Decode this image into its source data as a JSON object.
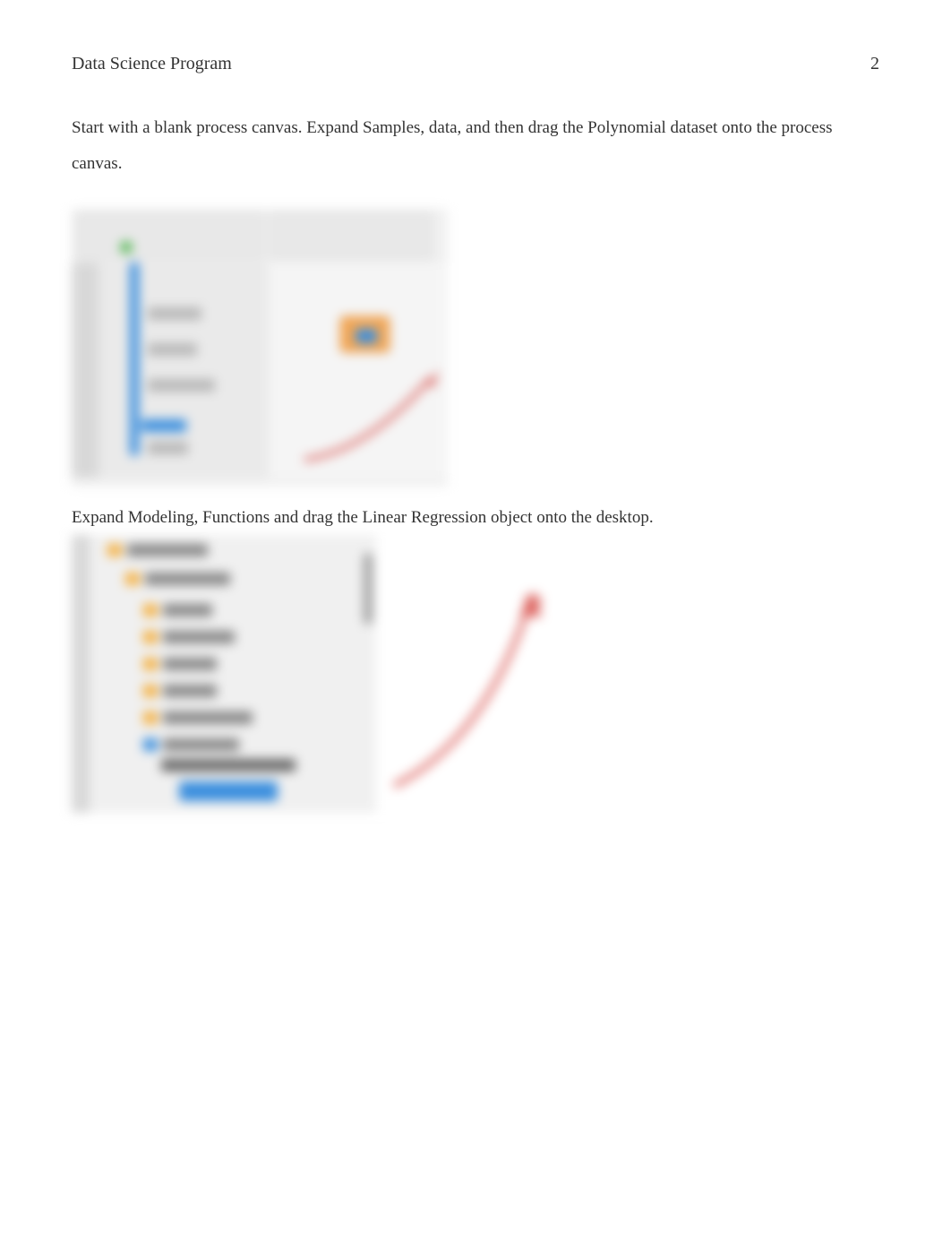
{
  "header": {
    "title": "Data Science Program",
    "page_number": "2"
  },
  "paragraphs": {
    "p1": "Start with a blank process        canvas.     Expand Samples, data, and then drag the Polynomial dataset onto the process canvas.",
    "p2": "Expand Modeling, Functions and drag the Linear Regression object onto the desktop."
  }
}
